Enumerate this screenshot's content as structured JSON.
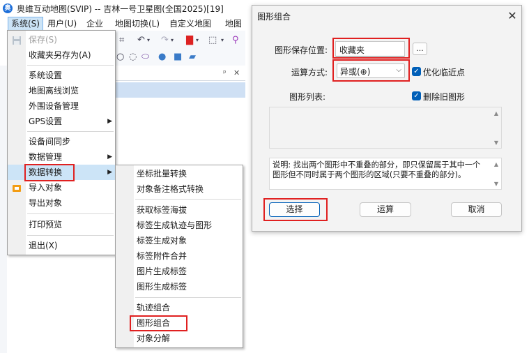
{
  "app": {
    "title": "奥维互动地图(SVIP) -- 吉林一号卫星图(全国2025)[19]",
    "menubar": [
      "系统(S)",
      "用户(U)",
      "企业",
      "地图切换(L)",
      "自定义地图",
      "地图"
    ]
  },
  "system_menu": {
    "items": [
      {
        "label": "保存(S)",
        "disabled": true
      },
      {
        "label": "收藏夹另存为(A)"
      },
      {
        "label": "系统设置"
      },
      {
        "label": "地图离线浏览"
      },
      {
        "label": "外围设备管理"
      },
      {
        "label": "GPS设置",
        "submenu": true
      },
      {
        "label": "设备间同步"
      },
      {
        "label": "数据管理",
        "submenu": true
      },
      {
        "label": "数据转换",
        "submenu": true,
        "highlighted": true
      },
      {
        "label": "导入对象"
      },
      {
        "label": "导出对象"
      },
      {
        "label": "打印预览"
      },
      {
        "label": "退出(X)"
      }
    ]
  },
  "convert_submenu": {
    "items": [
      "坐标批量转换",
      "对象备注格式转换",
      "获取标签海拔",
      "标签生成轨迹与图形",
      "标签生成对象",
      "标签附件合并",
      "图片生成标签",
      "图形生成标签",
      "轨迹组合",
      "图形组合",
      "对象分解"
    ]
  },
  "dialog": {
    "title": "图形组合",
    "save_location_label": "图形保存位置:",
    "save_location_value": "收藏夹",
    "browse_label": "...",
    "operation_label": "运算方式:",
    "operation_value": "异或(⊕)",
    "optimize_label": "优化临近点",
    "shape_list_label": "图形列表:",
    "delete_old_label": "删除旧图形",
    "description": "说明: 找出两个图形中不重叠的部分，即只保留属于其中一个图形但不同时属于两个图形的区域(只要不重叠的部分)。",
    "select_button": "选择",
    "compute_button": "运算",
    "cancel_button": "取消"
  },
  "colors": {
    "accent": "#005fb8",
    "highlight_box": "#e02020",
    "menu_highlight": "#cce4f7"
  }
}
